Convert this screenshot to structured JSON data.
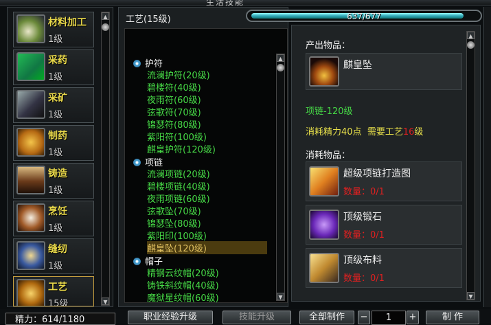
{
  "window": {
    "title": "生活技能"
  },
  "categories": [
    {
      "name": "材料加工",
      "level": "1级"
    },
    {
      "name": "采药",
      "level": "1级"
    },
    {
      "name": "采矿",
      "level": "1级"
    },
    {
      "name": "制药",
      "level": "1级"
    },
    {
      "name": "铸造",
      "level": "1级"
    },
    {
      "name": "烹饪",
      "level": "1级"
    },
    {
      "name": "缝纫",
      "level": "1级"
    },
    {
      "name": "工艺",
      "level": "15级"
    }
  ],
  "craft_panel": {
    "title": "工艺(15级)",
    "experience": {
      "text": "637/677",
      "fraction": 0.941
    }
  },
  "recipe_list": [
    {
      "group": "护符",
      "items": [
        "流澜护符(20级)",
        "碧楼符(40级)",
        "夜雨符(60级)",
        "弦歌符(70级)",
        "锦瑟符(80级)",
        "紫阳符(100级)",
        "麒皇护符(120级)"
      ]
    },
    {
      "group": "项链",
      "items": [
        "流澜项链(20级)",
        "碧楼项链(40级)",
        "夜雨项链(60级)",
        "弦歌坠(70级)",
        "锦瑟坠(80级)",
        "紫阳印(100级)",
        "麒皇坠(120级)"
      ]
    },
    {
      "group": "帽子",
      "items": [
        "精钢云纹帽(20级)",
        "铸铁斜纹帽(40级)",
        "魔狱星纹帽(60级)"
      ]
    }
  ],
  "selected_item": "麒皇坠(120级)",
  "detail": {
    "output_label": "产出物品：",
    "output_item": "麒皇坠",
    "item_type": "项链-120级",
    "energy_cost": "消耗精力40点",
    "req_prefix": "需要工艺",
    "req_level": "16",
    "req_suffix": "级",
    "consume_label": "消耗物品：",
    "materials": [
      {
        "name": "超级项链打造图",
        "count": "数量：0/1"
      },
      {
        "name": "顶级锻石",
        "count": "数量：0/1"
      },
      {
        "name": "顶级布料",
        "count": "数量：0/1"
      }
    ]
  },
  "bottom": {
    "energy": "精力：614/1180",
    "career_upgrade": "职业经验升级",
    "skill_upgrade": "技能升级",
    "make_all": "全部制作",
    "minus": "−",
    "quantity": "1",
    "plus": "+",
    "make": "制 作"
  },
  "colors": {
    "level_green": "#46d846",
    "selected_bg": "#4b3b0f",
    "warning_red": "#e02020",
    "title_yellow": "#e8d84a"
  }
}
